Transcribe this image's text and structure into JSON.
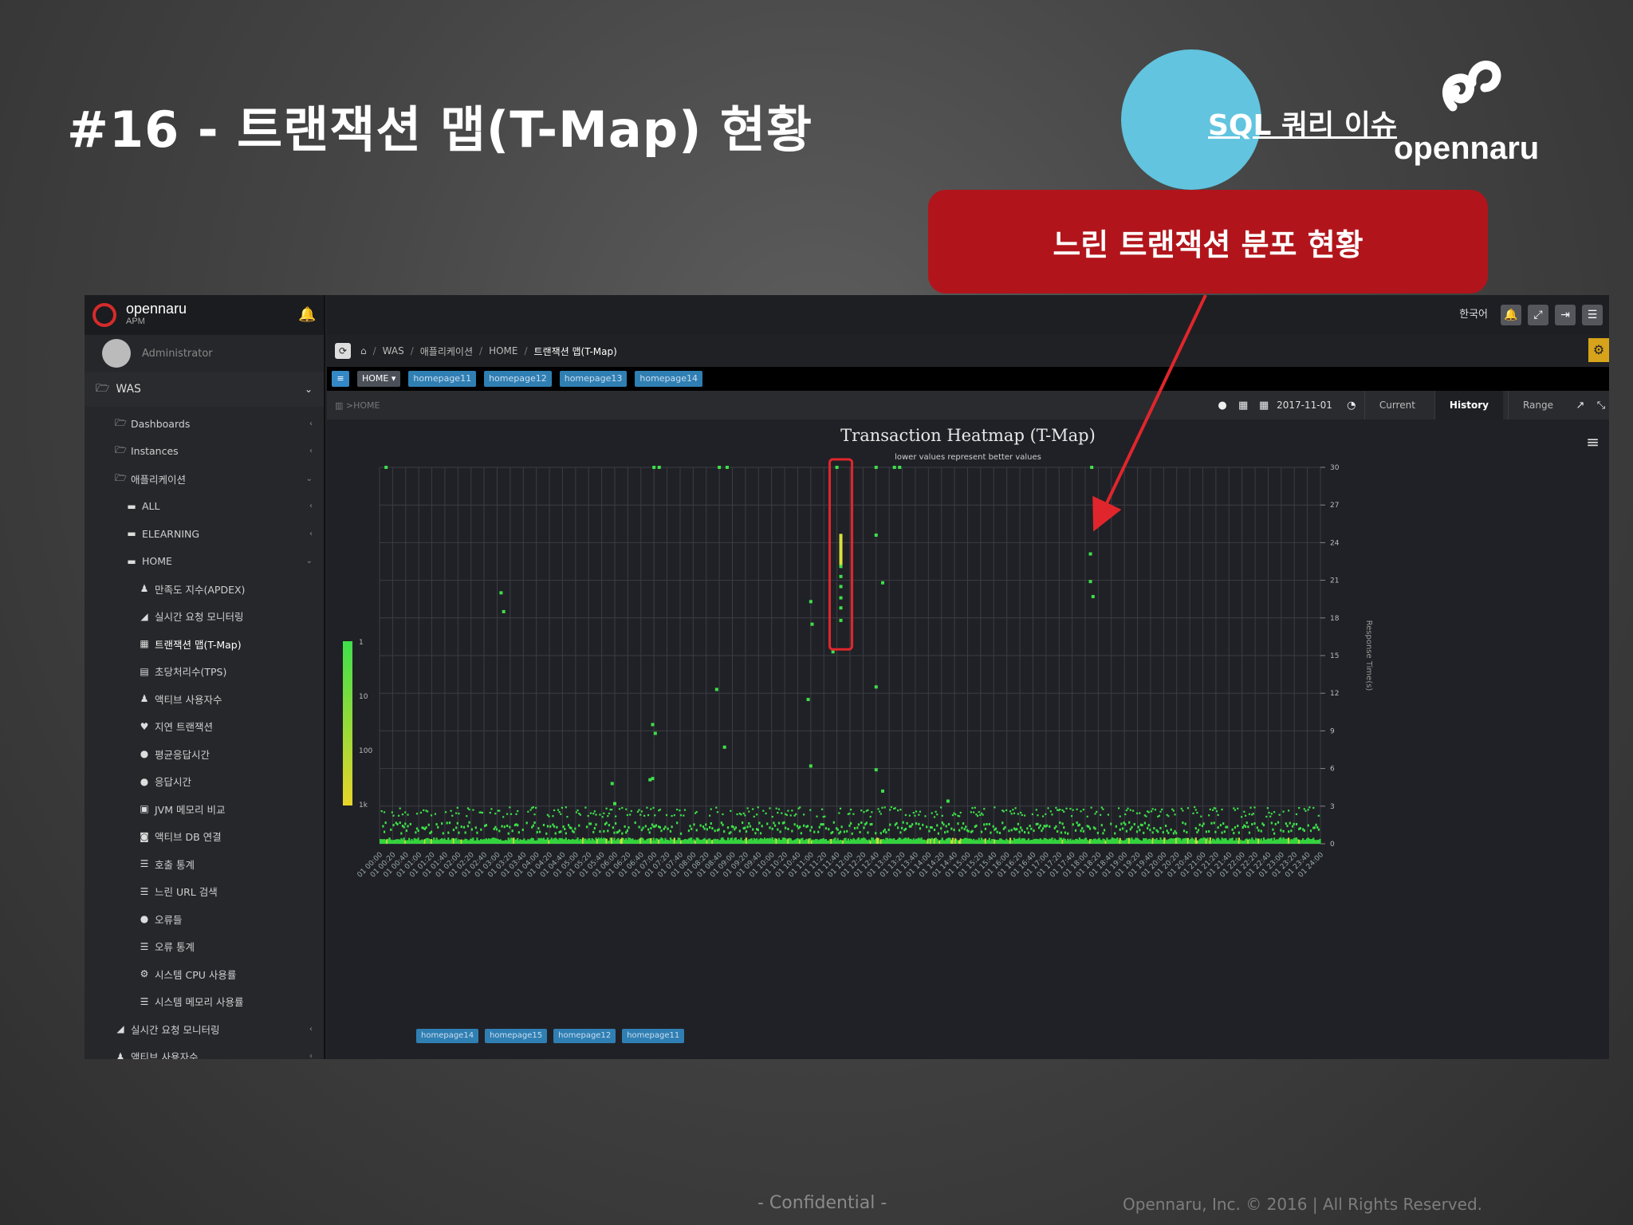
{
  "slide": {
    "title": "#16 - 트랜잭션 맵(T-Map) 현황",
    "sql_link": "SQL 쿼리 이슈",
    "brand": "opennaru",
    "callout": "느린 트랜잭션 분포 현황",
    "footer_confidential": "- Confidential -",
    "footer_copyright": "Opennaru, Inc. ©  2016 | All Rights Reserved."
  },
  "colors": {
    "accent_red": "#b1151b",
    "circle": "#62c4df",
    "heat_green": "#3ee04a",
    "heat_yellow": "#e8d52a"
  },
  "app": {
    "logo_name": "opennaru",
    "logo_sub": "APM",
    "user": "Administrator",
    "group": "WAS",
    "sidebar": [
      {
        "label": "Dashboards",
        "icon": "folder-icon",
        "level": 1
      },
      {
        "label": "Instances",
        "icon": "folder-icon",
        "level": 1
      },
      {
        "label": "애플리케이션",
        "icon": "folder-icon",
        "level": 1
      },
      {
        "label": "ALL",
        "icon": "server-icon",
        "level": 2
      },
      {
        "label": "ELEARNING",
        "icon": "server-icon",
        "level": 2
      },
      {
        "label": "HOME",
        "icon": "server-icon",
        "level": 2
      },
      {
        "label": "만족도 지수(APDEX)",
        "icon": "users-icon",
        "level": 3
      },
      {
        "label": "실시간 요청 모니터링",
        "icon": "chart-icon",
        "level": 3
      },
      {
        "label": "트랜잭션 맵(T-Map)",
        "icon": "grid-icon",
        "level": 3
      },
      {
        "label": "초당처리수(TPS)",
        "icon": "bar-icon",
        "level": 3
      },
      {
        "label": "액티브 사용자수",
        "icon": "users-icon",
        "level": 3
      },
      {
        "label": "지연 트랜잭션",
        "icon": "heart-icon",
        "level": 3
      },
      {
        "label": "평균응답시간",
        "icon": "clock-icon",
        "level": 3
      },
      {
        "label": "응답시간",
        "icon": "clock-icon",
        "level": 3
      },
      {
        "label": "JVM 메모리 비교",
        "icon": "memory-icon",
        "level": 3
      },
      {
        "label": "액티브 DB 연결",
        "icon": "db-icon",
        "level": 3
      },
      {
        "label": "호출 통계",
        "icon": "table-icon",
        "level": 3
      },
      {
        "label": "느린 URL 검색",
        "icon": "table-icon",
        "level": 3
      },
      {
        "label": "오류들",
        "icon": "clock-icon",
        "level": 3
      },
      {
        "label": "오류 통계",
        "icon": "table-icon",
        "level": 3
      },
      {
        "label": "시스템 CPU 사용률",
        "icon": "cpu-icon",
        "level": 3
      },
      {
        "label": "시스템 메모리 사용률",
        "icon": "table-icon",
        "level": 3
      },
      {
        "label": "실시간 요청 모니터링",
        "icon": "chart-icon",
        "level": 1
      },
      {
        "label": "액티브 사용자수",
        "icon": "users-icon",
        "level": 1
      }
    ],
    "language": "한국어",
    "breadcrumb": [
      "WAS",
      "애플리케이션",
      "HOME",
      "트랜잭션 맵(T-Map)"
    ],
    "tags": [
      "HOME",
      "homepage11",
      "homepage12",
      "homepage13",
      "homepage14"
    ],
    "filter": "HOME",
    "date": "2017-11-01",
    "modes": [
      "Current",
      "History",
      "Range"
    ],
    "active_mode": "History",
    "bottom_tags": [
      "homepage14",
      "homepage15",
      "homepage12",
      "homepage11"
    ]
  },
  "chart_data": {
    "type": "heatmap",
    "title": "Transaction Heatmap (T-Map)",
    "subtitle": "lower values represent better values",
    "ylabel": "Response Time(s)",
    "yticks": [
      0,
      3,
      6,
      9,
      12,
      15,
      18,
      21,
      24,
      27,
      30
    ],
    "ylim": [
      0,
      30
    ],
    "xlim_minutes": [
      0,
      1440
    ],
    "xtick_step_minutes": 20,
    "xtick_date": "01",
    "legend": {
      "labels": [
        "1",
        "10",
        "100",
        "1k"
      ],
      "colors": [
        "#3ee04a",
        "#e8d52a"
      ]
    },
    "outliers": [
      {
        "t": 10,
        "rt": 30
      },
      {
        "t": 420,
        "rt": 30
      },
      {
        "t": 428,
        "rt": 30
      },
      {
        "t": 520,
        "rt": 30
      },
      {
        "t": 532,
        "rt": 30
      },
      {
        "t": 700,
        "rt": 30
      },
      {
        "t": 760,
        "rt": 30
      },
      {
        "t": 788,
        "rt": 30
      },
      {
        "t": 796,
        "rt": 30
      },
      {
        "t": 1090,
        "rt": 30
      },
      {
        "t": 186,
        "rt": 20
      },
      {
        "t": 190,
        "rt": 18.5
      },
      {
        "t": 356,
        "rt": 4.8
      },
      {
        "t": 418,
        "rt": 9.5
      },
      {
        "t": 422,
        "rt": 8.8
      },
      {
        "t": 414,
        "rt": 5.1
      },
      {
        "t": 516,
        "rt": 12.3
      },
      {
        "t": 528,
        "rt": 7.7
      },
      {
        "t": 360,
        "rt": 3.2
      },
      {
        "t": 418,
        "rt": 5.2
      },
      {
        "t": 660,
        "rt": 19.3
      },
      {
        "t": 662,
        "rt": 17.5
      },
      {
        "t": 656,
        "rt": 11.5
      },
      {
        "t": 660,
        "rt": 6.2
      },
      {
        "t": 694,
        "rt": 15.3
      },
      {
        "t": 706,
        "rt": 22.8
      },
      {
        "t": 706,
        "rt": 22.1
      },
      {
        "t": 706,
        "rt": 21.3
      },
      {
        "t": 706,
        "rt": 20.5
      },
      {
        "t": 706,
        "rt": 19.6
      },
      {
        "t": 706,
        "rt": 18.8
      },
      {
        "t": 706,
        "rt": 17.8
      },
      {
        "t": 760,
        "rt": 24.6
      },
      {
        "t": 770,
        "rt": 20.8
      },
      {
        "t": 760,
        "rt": 12.5
      },
      {
        "t": 760,
        "rt": 5.9
      },
      {
        "t": 770,
        "rt": 4.2
      },
      {
        "t": 870,
        "rt": 3.4
      },
      {
        "t": 1088,
        "rt": 23.1
      },
      {
        "t": 1088,
        "rt": 20.9
      },
      {
        "t": 1092,
        "rt": 19.7
      }
    ],
    "hot_column": {
      "t": 706,
      "from": 24.7,
      "to": 24.0
    },
    "highlight": {
      "t": 706,
      "from": 16,
      "to": 30
    }
  }
}
